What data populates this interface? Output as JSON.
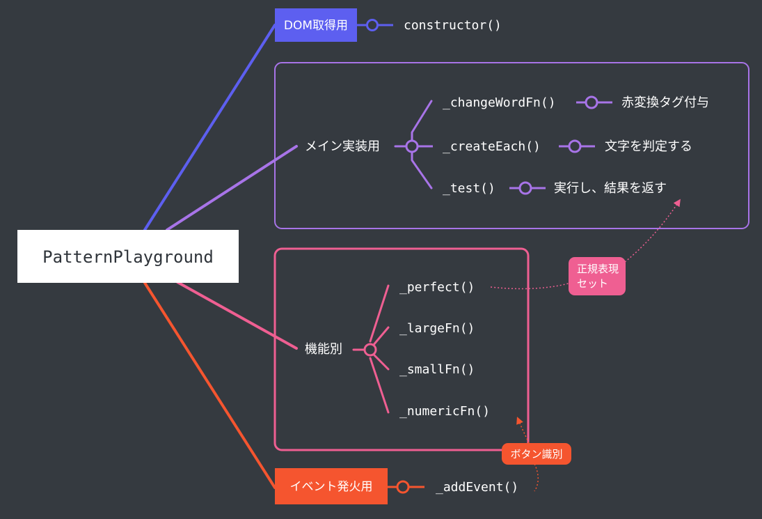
{
  "root": {
    "label": "PatternPlayground"
  },
  "colors": {
    "background": "#353a40",
    "blue": "#5d5ff0",
    "purple": "#a874e8",
    "pink": "#ef5f92",
    "orange": "#f5552f",
    "root_fill": "#ffffff",
    "root_text": "#2f343a"
  },
  "branches": {
    "dom": {
      "label": "DOM取得用",
      "method": "constructor()"
    },
    "main": {
      "label": "メイン実装用",
      "items": [
        {
          "method": "_changeWordFn()",
          "note": "赤変換タグ付与"
        },
        {
          "method": "_createEach()",
          "note": "文字を判定する"
        },
        {
          "method": "_test()",
          "note": "実行し、結果を返す"
        }
      ]
    },
    "feature": {
      "label": "機能別",
      "items": [
        {
          "method": "_perfect()"
        },
        {
          "method": "_largeFn()"
        },
        {
          "method": "_smallFn()"
        },
        {
          "method": "_numericFn()"
        }
      ]
    },
    "event": {
      "label": "イベント発火用",
      "method": "_addEvent()"
    }
  },
  "callouts": {
    "regex": {
      "line1": "正規表現",
      "line2": "セット"
    },
    "button": {
      "label": "ボタン識別"
    }
  }
}
